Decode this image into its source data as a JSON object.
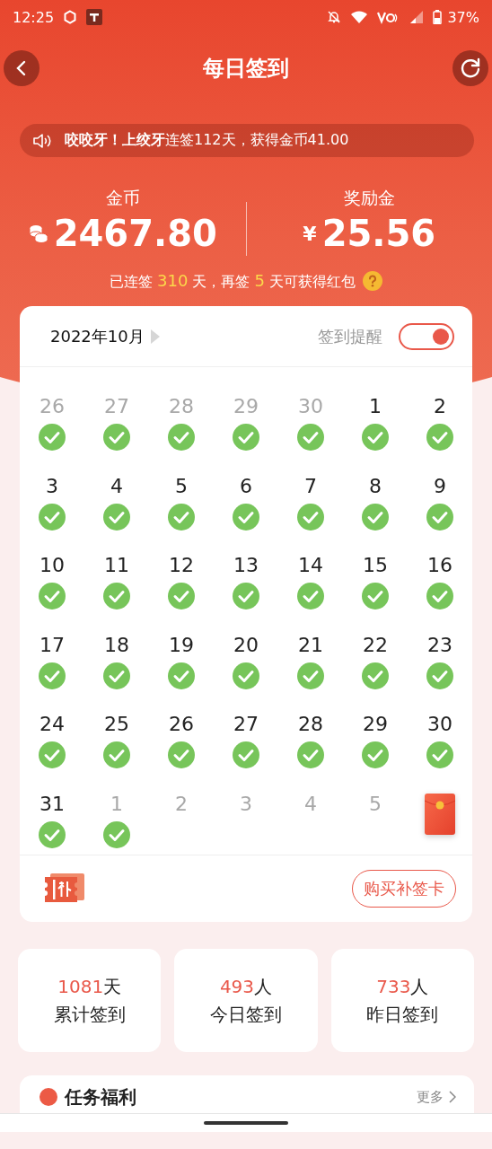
{
  "status_bar": {
    "time": "12:25",
    "battery": "37%"
  },
  "header": {
    "title": "每日签到"
  },
  "notice": {
    "text": "**咬咬牙！上绞牙**连签112天，获得金币41.00"
  },
  "balances": [
    {
      "kind": "coins",
      "label": "金币",
      "value": "2467.80"
    },
    {
      "kind": "cash",
      "label": "奖励金",
      "symbol": "¥",
      "value": "25.56"
    }
  ],
  "streak": {
    "prefix": "已连签",
    "days": "310",
    "middle": "天，再签",
    "remaining": "5",
    "suffix": "天可获得红包"
  },
  "calendar": {
    "month": "2022年10月",
    "reminder_label": "签到提醒",
    "reminder_on": true,
    "days": [
      {
        "kind": "day",
        "day": "26",
        "in_month": false,
        "checked": true
      },
      {
        "kind": "day",
        "day": "27",
        "in_month": false,
        "checked": true
      },
      {
        "kind": "day",
        "day": "28",
        "in_month": false,
        "checked": true
      },
      {
        "kind": "day",
        "day": "29",
        "in_month": false,
        "checked": true
      },
      {
        "kind": "day",
        "day": "30",
        "in_month": false,
        "checked": true
      },
      {
        "kind": "day",
        "day": "1",
        "in_month": true,
        "checked": true
      },
      {
        "kind": "day",
        "day": "2",
        "in_month": true,
        "checked": true
      },
      {
        "kind": "day",
        "day": "3",
        "in_month": true,
        "checked": true
      },
      {
        "kind": "day",
        "day": "4",
        "in_month": true,
        "checked": true
      },
      {
        "kind": "day",
        "day": "5",
        "in_month": true,
        "checked": true
      },
      {
        "kind": "day",
        "day": "6",
        "in_month": true,
        "checked": true
      },
      {
        "kind": "day",
        "day": "7",
        "in_month": true,
        "checked": true
      },
      {
        "kind": "day",
        "day": "8",
        "in_month": true,
        "checked": true
      },
      {
        "kind": "day",
        "day": "9",
        "in_month": true,
        "checked": true
      },
      {
        "kind": "day",
        "day": "10",
        "in_month": true,
        "checked": true
      },
      {
        "kind": "day",
        "day": "11",
        "in_month": true,
        "checked": true
      },
      {
        "kind": "day",
        "day": "12",
        "in_month": true,
        "checked": true
      },
      {
        "kind": "day",
        "day": "13",
        "in_month": true,
        "checked": true
      },
      {
        "kind": "day",
        "day": "14",
        "in_month": true,
        "checked": true
      },
      {
        "kind": "day",
        "day": "15",
        "in_month": true,
        "checked": true
      },
      {
        "kind": "day",
        "day": "16",
        "in_month": true,
        "checked": true
      },
      {
        "kind": "day",
        "day": "17",
        "in_month": true,
        "checked": true
      },
      {
        "kind": "day",
        "day": "18",
        "in_month": true,
        "checked": true
      },
      {
        "kind": "day",
        "day": "19",
        "in_month": true,
        "checked": true
      },
      {
        "kind": "day",
        "day": "20",
        "in_month": true,
        "checked": true
      },
      {
        "kind": "day",
        "day": "21",
        "in_month": true,
        "checked": true
      },
      {
        "kind": "day",
        "day": "22",
        "in_month": true,
        "checked": true
      },
      {
        "kind": "day",
        "day": "23",
        "in_month": true,
        "checked": true
      },
      {
        "kind": "day",
        "day": "24",
        "in_month": true,
        "checked": true
      },
      {
        "kind": "day",
        "day": "25",
        "in_month": true,
        "checked": true
      },
      {
        "kind": "day",
        "day": "26",
        "in_month": true,
        "checked": true
      },
      {
        "kind": "day",
        "day": "27",
        "in_month": true,
        "checked": true
      },
      {
        "kind": "day",
        "day": "28",
        "in_month": true,
        "checked": true
      },
      {
        "kind": "day",
        "day": "29",
        "in_month": true,
        "checked": true
      },
      {
        "kind": "day",
        "day": "30",
        "in_month": true,
        "checked": true
      },
      {
        "kind": "day",
        "day": "31",
        "in_month": true,
        "checked": true
      },
      {
        "kind": "day",
        "day": "1",
        "in_month": false,
        "checked": true
      },
      {
        "kind": "day",
        "day": "2",
        "in_month": false,
        "checked": false
      },
      {
        "kind": "day",
        "day": "3",
        "in_month": false,
        "checked": false
      },
      {
        "kind": "day",
        "day": "4",
        "in_month": false,
        "checked": false
      },
      {
        "kind": "day",
        "day": "5",
        "in_month": false,
        "checked": false
      },
      {
        "kind": "red_packet"
      }
    ],
    "buy_button": "购买补签卡"
  },
  "stats": [
    {
      "value": "1081",
      "unit": "天",
      "label": "累计签到"
    },
    {
      "value": "493",
      "unit": "人",
      "label": "今日签到"
    },
    {
      "value": "733",
      "unit": "人",
      "label": "昨日签到"
    }
  ],
  "tasks": {
    "title": "任务福利",
    "more": "更多"
  }
}
